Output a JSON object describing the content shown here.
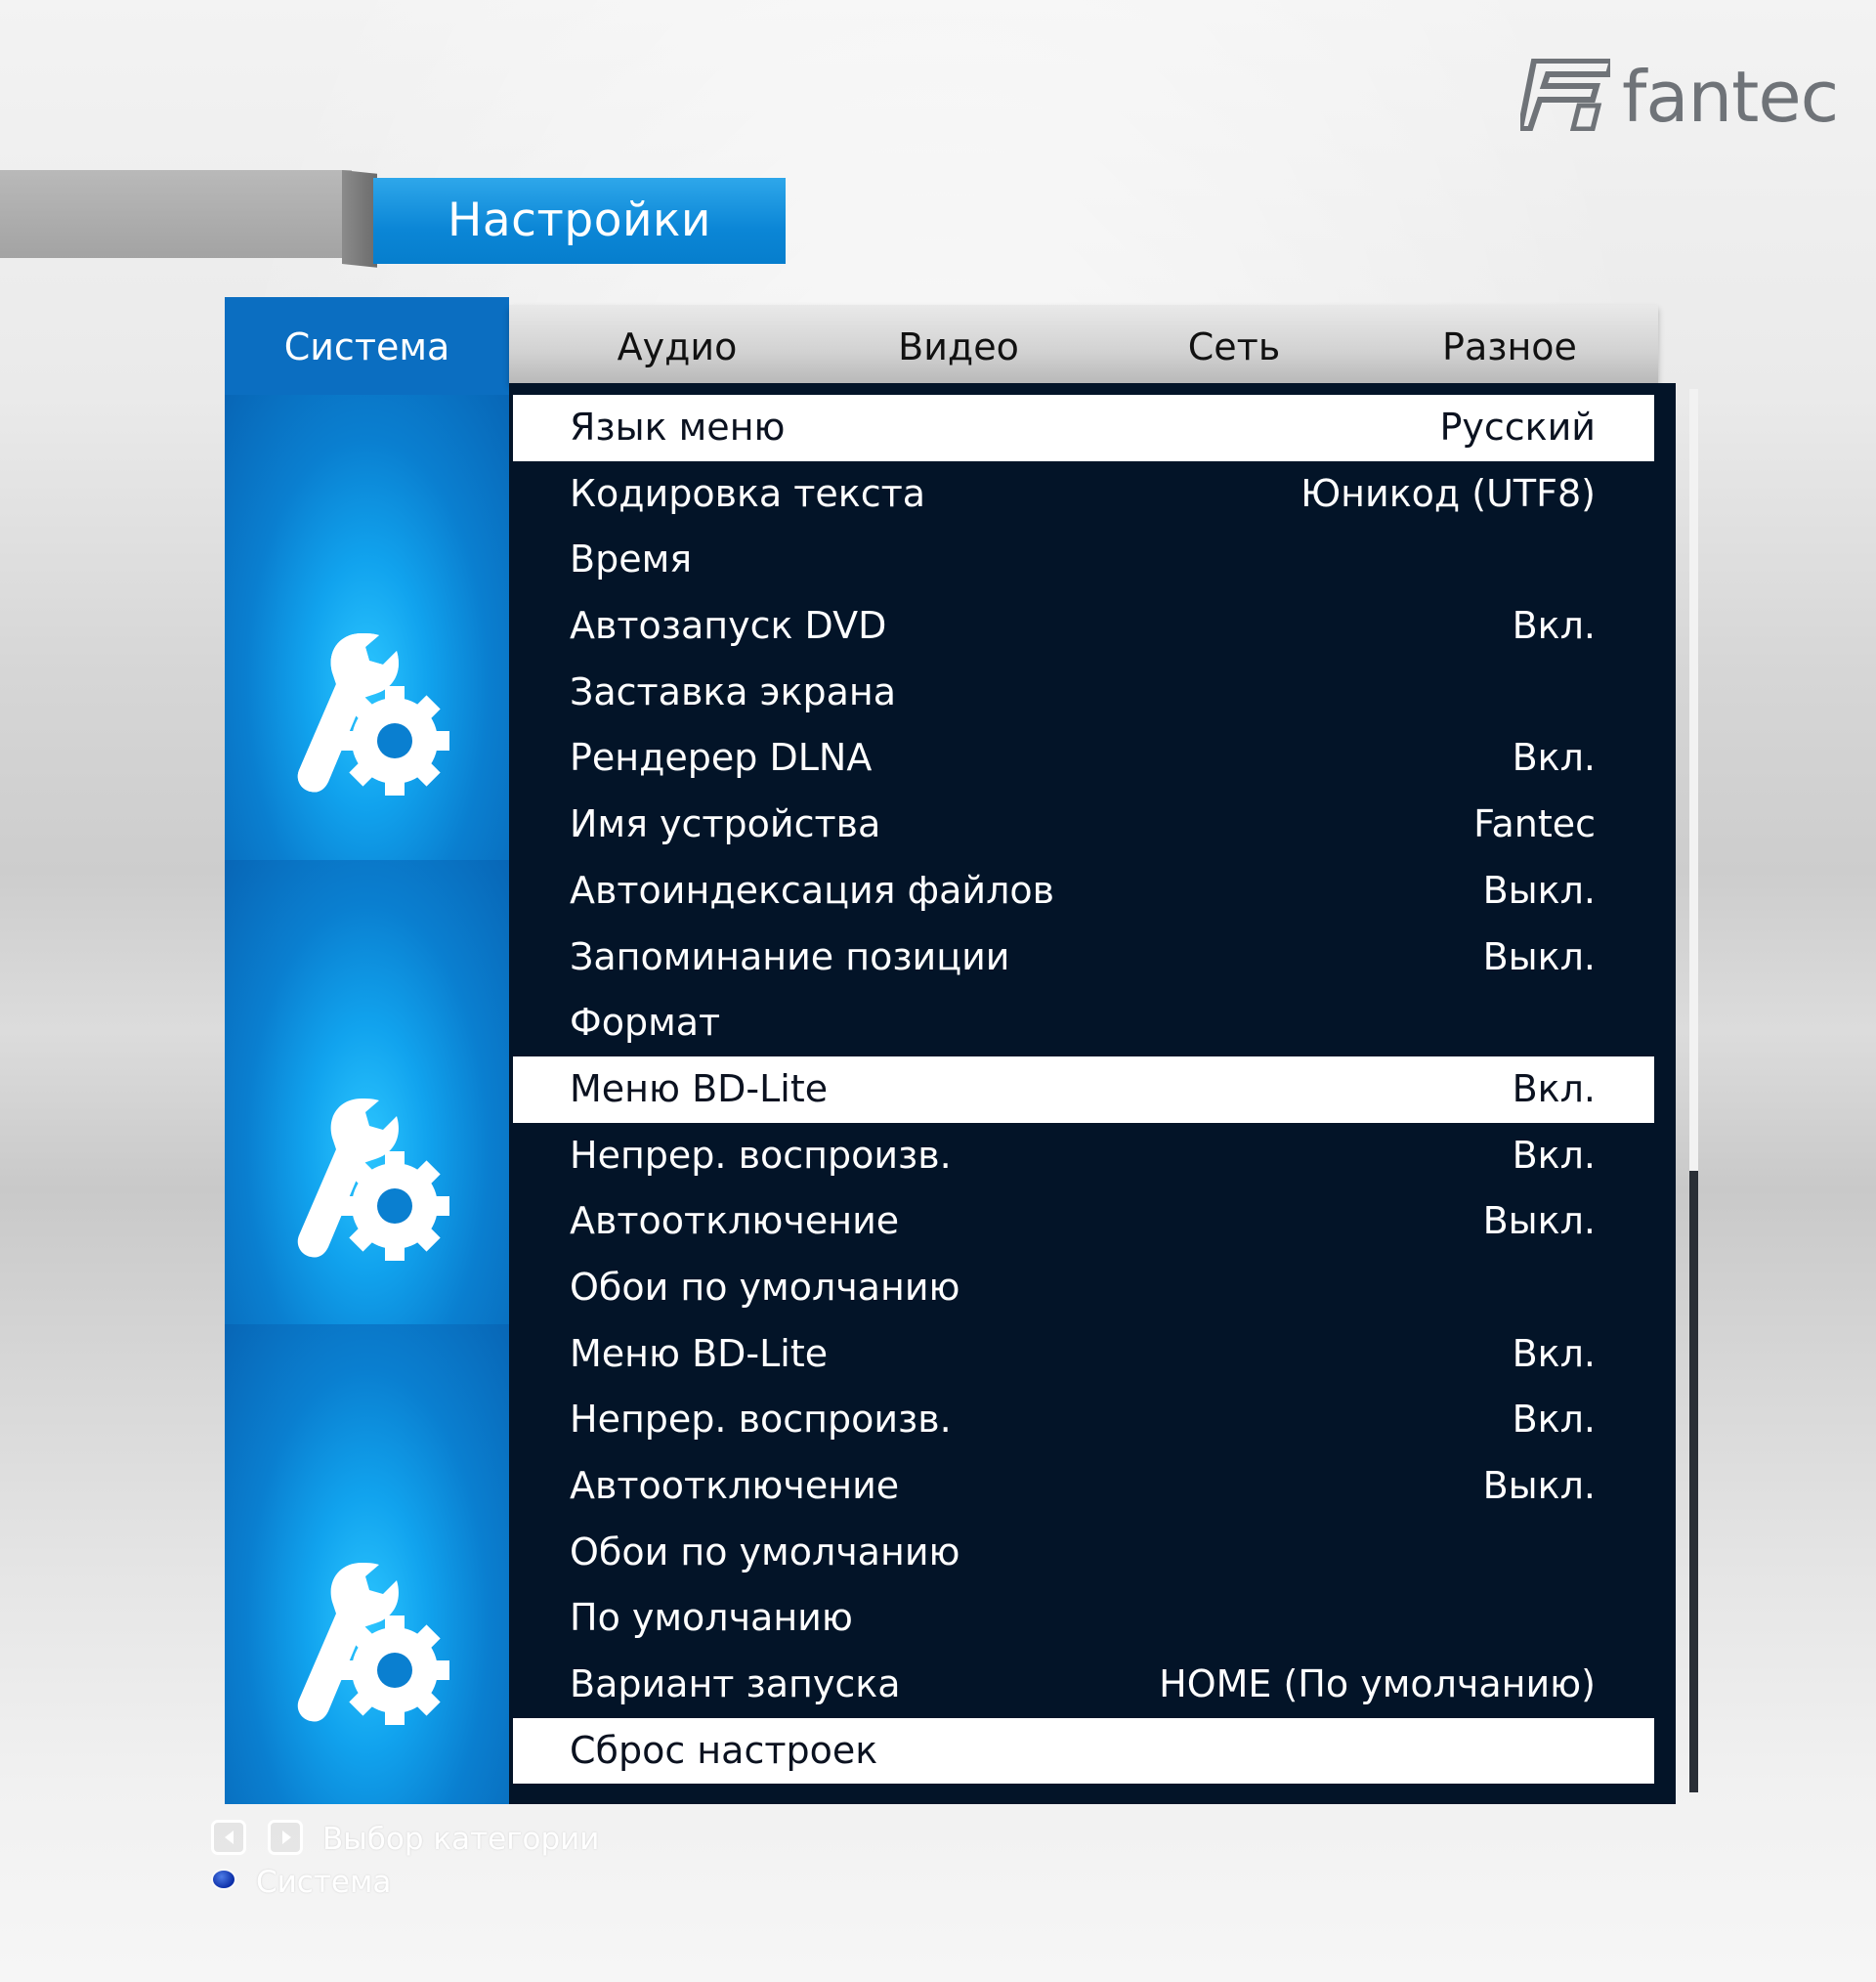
{
  "brand": {
    "name": "fantec",
    "logo_mark": "F"
  },
  "header": {
    "title": "Настройки"
  },
  "sidebar": {
    "category": "Система",
    "icons": [
      "wrench-gear-icon",
      "wrench-gear-icon",
      "wrench-gear-icon"
    ]
  },
  "tabs": [
    "Аудио",
    "Видео",
    "Сеть",
    "Разное"
  ],
  "settings": [
    {
      "label": "Язык меню",
      "value": "Русский",
      "selected": true
    },
    {
      "label": "Кодировка текста",
      "value": "Юникод (UTF8)"
    },
    {
      "label": "Время",
      "value": ""
    },
    {
      "label": "Автозапуск DVD",
      "value": "Вкл."
    },
    {
      "label": "Заставка экрана",
      "value": ""
    },
    {
      "label": "Рендерер DLNA",
      "value": "Вкл."
    },
    {
      "label": "Имя устройства",
      "value": "Fantec"
    },
    {
      "label": "Автоиндексация файлов",
      "value": "Выкл."
    },
    {
      "label": "Запоминание позиции",
      "value": "Выкл."
    },
    {
      "label": "Формат",
      "value": ""
    },
    {
      "label": "Меню BD-Lite",
      "value": "Вкл.",
      "selected": true
    },
    {
      "label": "Непрер. воспроизв.",
      "value": "Вкл."
    },
    {
      "label": "Автоотключение",
      "value": "Выкл."
    },
    {
      "label": "Обои по умолчанию",
      "value": ""
    },
    {
      "label": "Меню BD-Lite",
      "value": "Вкл."
    },
    {
      "label": "Непрер. воспроизв.",
      "value": "Вкл."
    },
    {
      "label": "Автоотключение",
      "value": "Выкл."
    },
    {
      "label": "Обои по умолчанию",
      "value": ""
    },
    {
      "label": "По умолчанию",
      "value": ""
    },
    {
      "label": "Вариант запуска",
      "value": "HOME (По умолчанию)"
    },
    {
      "label": "Сброс настроек",
      "value": "",
      "selected": true
    }
  ],
  "footer": {
    "hint": "Выбор категории",
    "system": "Система",
    "icons": [
      "arrow-left-icon",
      "arrow-right-icon",
      "blue-dot-icon"
    ]
  }
}
